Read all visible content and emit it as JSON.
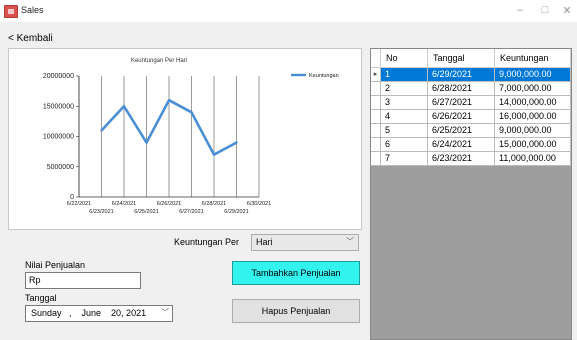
{
  "window": {
    "title": "Sales",
    "app_icon": "app-icon",
    "controls": [
      "minimize-icon",
      "maximize-icon",
      "close-icon"
    ]
  },
  "nav": {
    "back_label": "< Kembali"
  },
  "chart_data": {
    "type": "line",
    "title": "Keuntungan Per Hari",
    "x": [
      "6/22/2021",
      "6/23/2021",
      "6/24/2021",
      "6/25/2021",
      "6/26/2021",
      "6/27/2021",
      "6/28/2021",
      "6/29/2021",
      "6/30/2021"
    ],
    "x_ticks_top": [
      "6/22/2021",
      "6/24/2021",
      "6/26/2021",
      "6/28/2021",
      "6/30/2021"
    ],
    "x_ticks_bottom": [
      "6/23/2021",
      "6/25/2021",
      "6/27/2021",
      "6/29/2021"
    ],
    "series": [
      {
        "name": "Keuntungan",
        "color": "#4a8fd6",
        "points": [
          {
            "x": "6/23/2021",
            "y": 11000000
          },
          {
            "x": "6/24/2021",
            "y": 15000000
          },
          {
            "x": "6/25/2021",
            "y": 9000000
          },
          {
            "x": "6/26/2021",
            "y": 16000000
          },
          {
            "x": "6/27/2021",
            "y": 14000000
          },
          {
            "x": "6/28/2021",
            "y": 7000000
          },
          {
            "x": "6/29/2021",
            "y": 9000000
          }
        ]
      }
    ],
    "y_ticks": [
      "0",
      "5000000",
      "10000000",
      "15000000",
      "20000000"
    ],
    "ylim": [
      0,
      20000000
    ],
    "grid": "vertical",
    "legend": "top-right"
  },
  "grid": {
    "columns": [
      "No",
      "Tanggal",
      "Keuntungan"
    ],
    "selected_row": 0,
    "selection_color": "#0078d7",
    "rows": [
      [
        "1",
        "6/29/2021",
        "9,000,000.00"
      ],
      [
        "2",
        "6/28/2021",
        "7,000,000.00"
      ],
      [
        "3",
        "6/27/2021",
        "14,000,000.00"
      ],
      [
        "4",
        "6/26/2021",
        "16,000,000.00"
      ],
      [
        "5",
        "6/25/2021",
        "9,000,000.00"
      ],
      [
        "6",
        "6/24/2021",
        "15,000,000.00"
      ],
      [
        "7",
        "6/23/2021",
        "11,000,000.00"
      ]
    ]
  },
  "form": {
    "period_label": "Keuntungan Per",
    "period_value": "Hari",
    "sale_value_label": "Nilai Penjualan",
    "sale_value_input": "Rp",
    "date_label": "Tanggal",
    "date_value": "Sunday   ,    June    20, 2021",
    "add_button": "Tambahkan Penjualan",
    "add_button_color": "#33f3ee",
    "delete_button": "Hapus Penjualan"
  }
}
